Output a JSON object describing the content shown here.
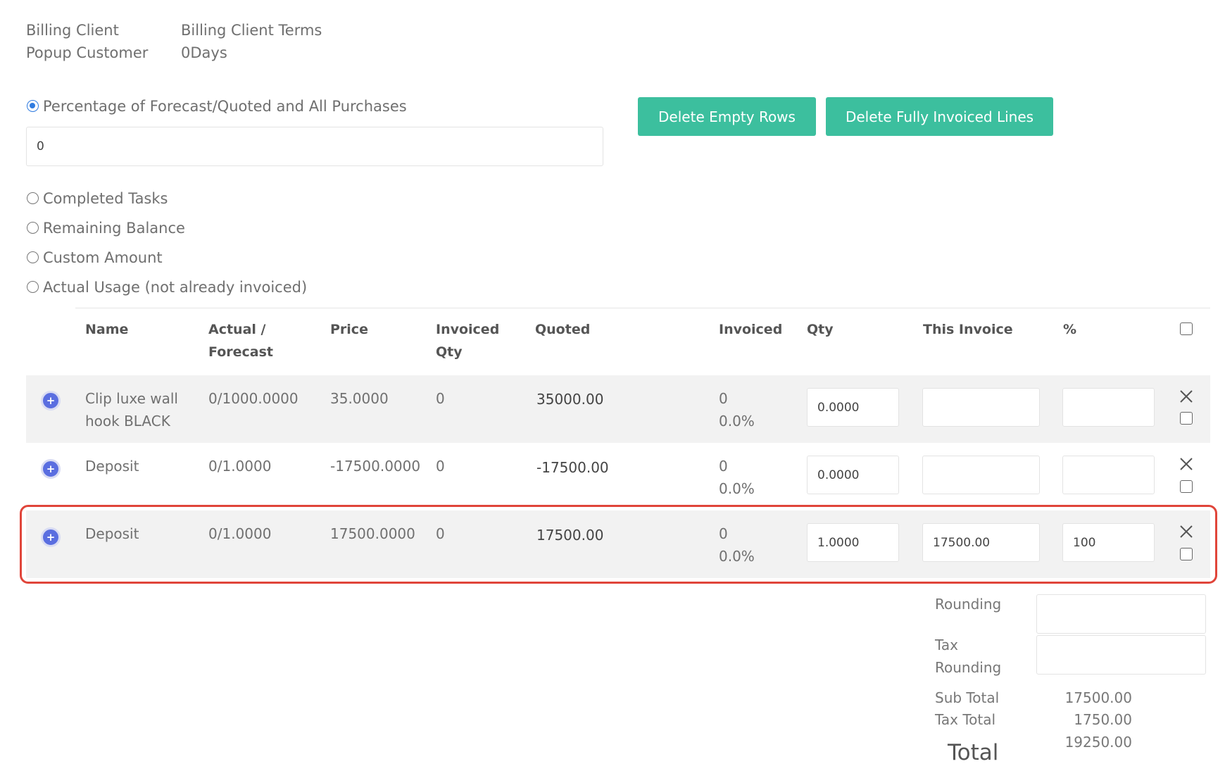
{
  "billing": {
    "client_label": "Billing Client",
    "client_value": "Popup Customer",
    "terms_label": "Billing Client Terms",
    "terms_value": "0Days"
  },
  "options": {
    "percentage_label": "Percentage of Forecast/Quoted and All Purchases",
    "percentage_value": "0",
    "completed_tasks": "Completed Tasks",
    "remaining_balance": "Remaining Balance",
    "custom_amount": "Custom Amount",
    "actual_usage": "Actual Usage (not already invoiced)"
  },
  "buttons": {
    "delete_empty": "Delete Empty Rows",
    "delete_invoiced": "Delete Fully Invoiced Lines"
  },
  "table": {
    "headers": {
      "name": "Name",
      "actual_line1": "Actual /",
      "actual_line2": "Forecast",
      "price": "Price",
      "invoiced_qty_line1": "Invoiced",
      "invoiced_qty_line2": "Qty",
      "quoted": "Quoted",
      "invoiced": "Invoiced",
      "qty": "Qty",
      "this_invoice": "This Invoice",
      "percent": "%"
    },
    "rows": [
      {
        "name_line1": "Clip luxe wall",
        "name_line2": "hook BLACK",
        "actual": "0/1000.0000",
        "price": "35.0000",
        "invoiced_qty": "0",
        "quoted": "35000.00",
        "invoiced": "0",
        "invoiced_pct": "0.0%",
        "qty": "0.0000",
        "this_invoice": "",
        "percent": ""
      },
      {
        "name_line1": "Deposit",
        "name_line2": "",
        "actual": "0/1.0000",
        "price": "-17500.0000",
        "invoiced_qty": "0",
        "quoted": "-17500.00",
        "invoiced": "0",
        "invoiced_pct": "0.0%",
        "qty": "0.0000",
        "this_invoice": "",
        "percent": ""
      },
      {
        "name_line1": "Deposit",
        "name_line2": "",
        "actual": "0/1.0000",
        "price": "17500.0000",
        "invoiced_qty": "0",
        "quoted": "17500.00",
        "invoiced": "0",
        "invoiced_pct": "0.0%",
        "qty": "1.0000",
        "this_invoice": "17500.00",
        "percent": "100"
      }
    ]
  },
  "totals": {
    "rounding_label": "Rounding",
    "rounding_value": "",
    "tax_rounding_line1": "Tax",
    "tax_rounding_line2": "Rounding",
    "tax_rounding_value": "",
    "subtotal_label": "Sub Total",
    "subtotal_value": "17500.00",
    "tax_total_label": "Tax Total",
    "tax_total_value": "1750.00",
    "total_label": "Total",
    "total_value": "19250.00"
  },
  "colors": {
    "button": "#3cbf9e",
    "highlight": "#e0453a",
    "radio_selected": "#2f7be0",
    "row_shade": "#f2f2f2"
  }
}
